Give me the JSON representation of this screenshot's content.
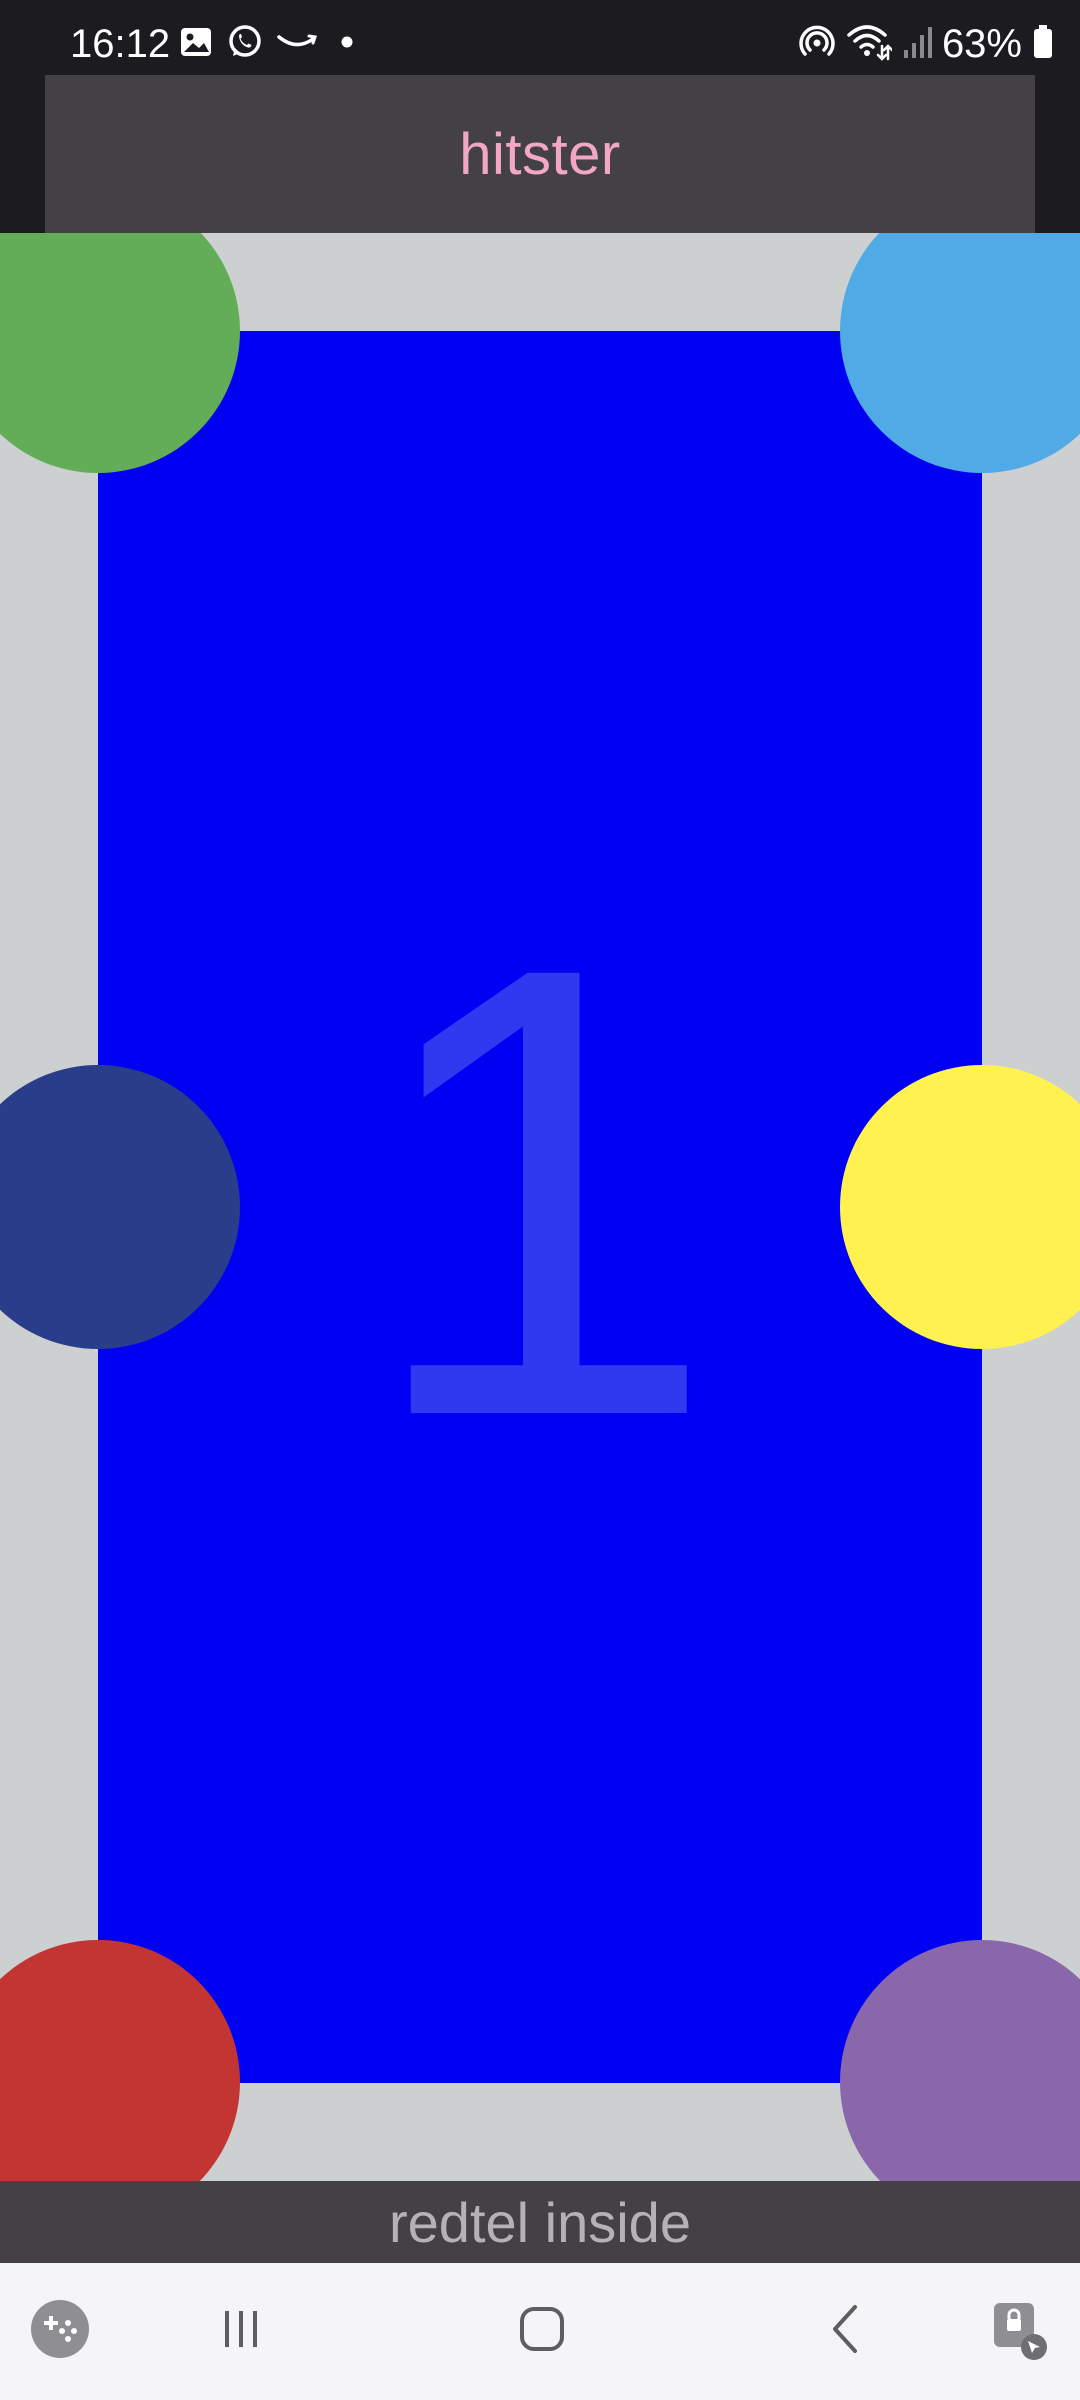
{
  "status_bar": {
    "time": "16:12",
    "battery": "63%",
    "left_icons": [
      "gallery-icon",
      "whatsapp-icon",
      "amazon-icon",
      "notification-dot-icon"
    ],
    "right_icons": [
      "hotspot-icon",
      "wifi-icon",
      "signal-icon",
      "battery-icon"
    ]
  },
  "app": {
    "title": "hitster",
    "footer": "redtel inside",
    "card_number": "1",
    "colors": {
      "title_text": "#f2a7c3",
      "board_background": "#cdd0d0",
      "card": "#0000f2"
    },
    "players": [
      {
        "name": "player-green",
        "color": "#63ad58"
      },
      {
        "name": "player-light-blue",
        "color": "#4faae6"
      },
      {
        "name": "player-navy",
        "color": "#293d8a"
      },
      {
        "name": "player-yellow",
        "color": "#fff250"
      },
      {
        "name": "player-red",
        "color": "#c23532"
      },
      {
        "name": "player-purple",
        "color": "#8a67ab"
      }
    ]
  },
  "nav_bar": {
    "items": [
      "game-tools-icon",
      "recent-apps-icon",
      "home-icon",
      "back-icon",
      "screen-lock-icon"
    ]
  }
}
